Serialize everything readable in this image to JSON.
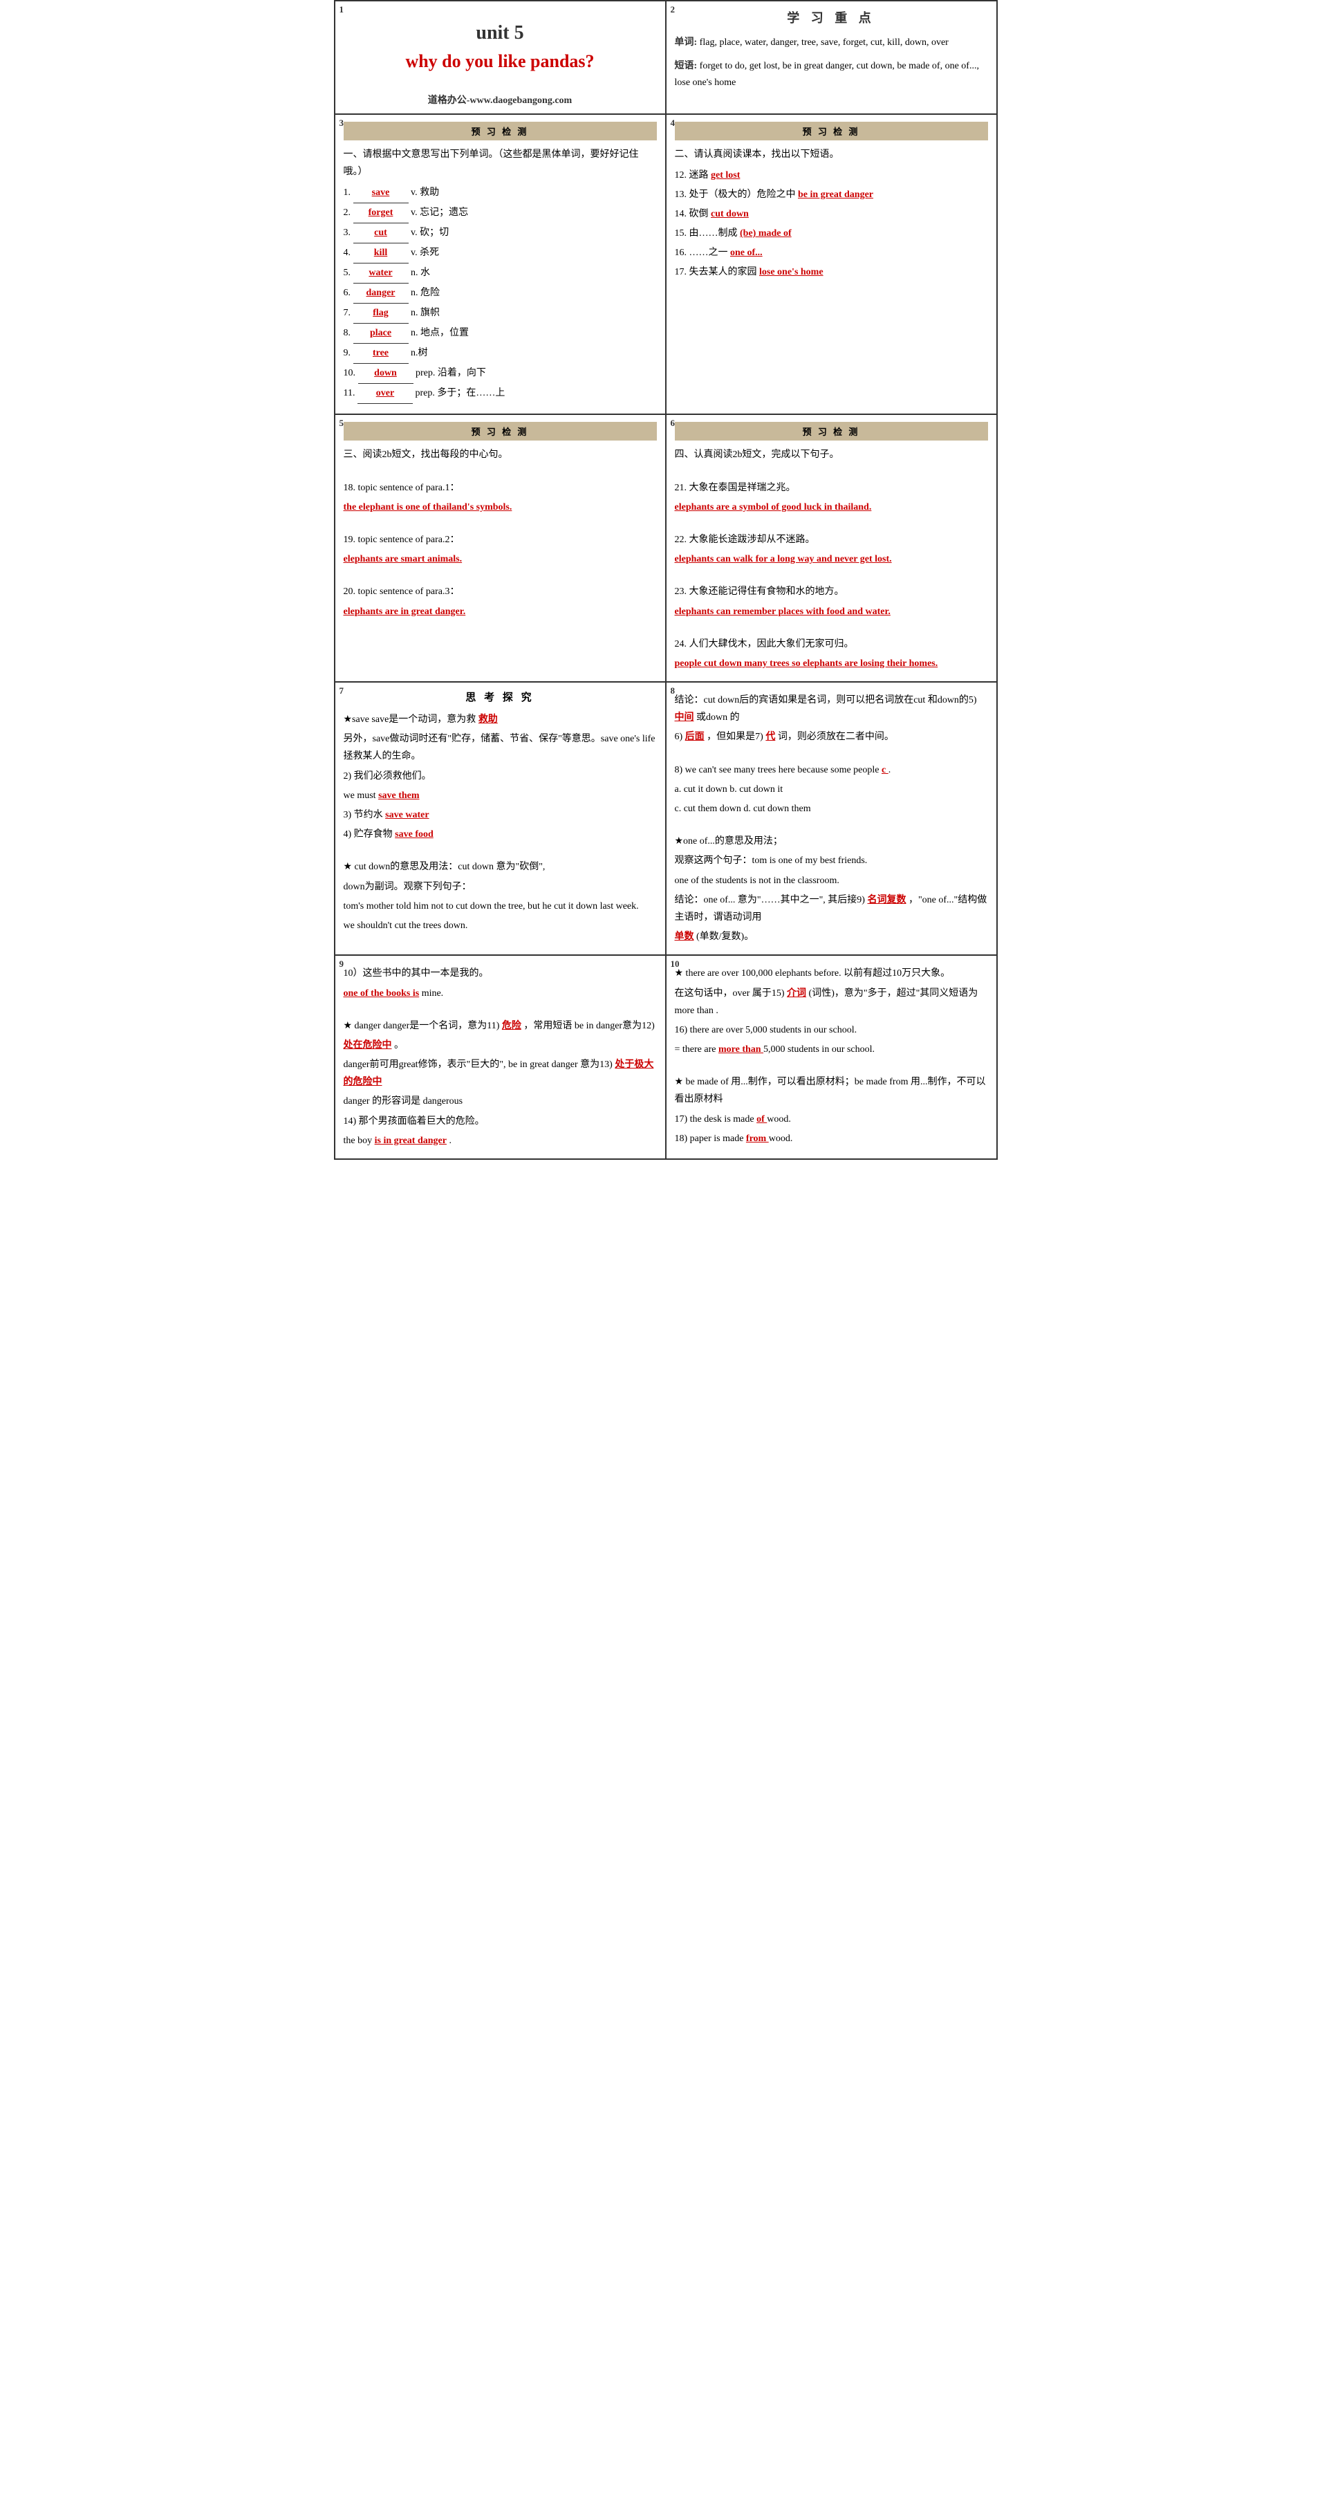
{
  "cell1": {
    "num": "1",
    "unit": "unit 5",
    "subtitle": "why do you like pandas?",
    "website": "道格办公-www.daogebangong.com"
  },
  "cell2": {
    "num": "2",
    "title": "学 习 重 点",
    "words_label": "单词:",
    "words": "flag, place, water, danger, tree, save, forget, cut, kill, down, over",
    "phrases_label": "短语:",
    "phrases": "forget to do, get lost, be in great danger, cut down, be made of, one of..., lose one's home"
  },
  "cell3": {
    "num": "3",
    "header": "预 习 检 测",
    "title": "一、请根据中文意思写出下列单词。（这些都是黑体单词，要好好记住哦。）",
    "items": [
      {
        "num": "1.",
        "blank": "save",
        "meaning": "v. 救助"
      },
      {
        "num": "2.",
        "blank": "forget",
        "meaning": "v. 忘记；遗忘"
      },
      {
        "num": "3.",
        "blank": "cut",
        "meaning": "v. 砍；切"
      },
      {
        "num": "4.",
        "blank": "kill",
        "meaning": "v. 杀死"
      },
      {
        "num": "5.",
        "blank": "water",
        "meaning": "n. 水"
      },
      {
        "num": "6.",
        "blank": "danger",
        "meaning": "n. 危险"
      },
      {
        "num": "7.",
        "blank": "flag",
        "meaning": "n. 旗帜"
      },
      {
        "num": "8.",
        "blank": "place",
        "meaning": "n. 地点，位置"
      },
      {
        "num": "9.",
        "blank": "tree",
        "meaning": "n.树"
      },
      {
        "num": "10.",
        "blank": "down",
        "meaning": "prep. 沿着，向下"
      },
      {
        "num": "11.",
        "blank": "over",
        "meaning": "prep. 多于；在……上"
      }
    ]
  },
  "cell4": {
    "num": "4",
    "header": "预 习 检 测",
    "title": "二、请认真阅读课本，找出以下短语。",
    "items": [
      {
        "num": "12.",
        "meaning": "迷路",
        "blank": "get lost"
      },
      {
        "num": "13.",
        "meaning": "处于（极大的）危险之中",
        "blank": "be in great danger"
      },
      {
        "num": "14.",
        "meaning": "砍倒",
        "blank": "cut down"
      },
      {
        "num": "15.",
        "meaning": "由……制成",
        "blank": "(be) made of"
      },
      {
        "num": "16.",
        "meaning": "……之一",
        "blank": "one of..."
      },
      {
        "num": "17.",
        "meaning": "失去某人的家园",
        "blank": "lose one's home"
      }
    ]
  },
  "cell5": {
    "num": "5",
    "header": "预 习 检 测",
    "title": "三、阅读2b短文，找出每段的中心句。",
    "items": [
      {
        "num": "18.",
        "label": "topic sentence of para.1：",
        "blank": "the elephant is one of thailand's symbols."
      },
      {
        "num": "19.",
        "label": "topic sentence of para.2：",
        "blank": "elephants are smart animals."
      },
      {
        "num": "20.",
        "label": "topic sentence of para.3：",
        "blank": "elephants are in great danger."
      }
    ]
  },
  "cell6": {
    "num": "6",
    "header": "预 习 检 测",
    "title": "四、认真阅读2b短文，完成以下句子。",
    "items": [
      {
        "num": "21.",
        "cn": "大象在泰国是祥瑞之兆。",
        "blank": "elephants are a symbol of good luck in thailand."
      },
      {
        "num": "22.",
        "cn": "大象能长途跋涉却从不迷路。",
        "blank": "elephants can walk for a long way and never get lost."
      },
      {
        "num": "23.",
        "cn": "大象还能记得住有食物和水的地方。",
        "blank": "elephants can remember places with food and water."
      },
      {
        "num": "24.",
        "cn": "人们大肆伐木，因此大象们无家可归。",
        "blank": "people cut down many trees so elephants are losing their homes."
      }
    ]
  },
  "cell7": {
    "num": "7",
    "header": "思 考 探 究",
    "content": [
      "★save  save是一个动词，意为救",
      "救助",
      "另外，save做动词时还有\"贮存，储蓄、节省、保存\"等意思。save one's life 拯救某人的生命。",
      "2) 我们必须救他们。",
      "we must  save them",
      "3) 节约水  save water",
      "4) 贮存食物  save food",
      "★ cut down的意思及用法：cut down 意为\"砍倒\",",
      "down为副词。观察下列句子：",
      "  tom's mother told him not to cut down the tree,",
      "but he cut it down last week.",
      "  we shouldn't cut the trees down."
    ]
  },
  "cell8": {
    "num": "8",
    "content": [
      "结论：cut down后的宾语如果是名词，则可以把名词放在cut 和down的5) 中间 或down 的",
      "6) 后面 ，但如果是7) 代 词，则必须放在二者中间。",
      "8) we can't see many trees here because some people  c  .",
      "  a. cut it down     b. cut down it",
      "  c. cut them down    d. cut down them",
      "★one of...的意思及用法；",
      "  观察这两个句子：tom is one of my best friends.",
      "one of the students is not in the classroom.",
      "  结论：one of... 意为\"……其中之一\", 其后接9)",
      "名词复数 ，\"one of...\"结构做主语时，谓语动词用",
      "单数 (单数/复数)。"
    ]
  },
  "cell9": {
    "num": "9",
    "content": [
      "10）这些书中的其中一本是我的。",
      "one of the books is  mine.",
      "★ danger  danger是一个名词，意为11)",
      "危险 ，常用短语 be in danger意为12)",
      "处在危险中 。",
      "danger前可用great修饰，表示\"巨大的\", be in great danger 意为13)  处于极大的危险中",
      "danger 的形容词是 dangerous",
      "14) 那个男孩面临着巨大的危险。",
      "the boy  is in great danger ."
    ]
  },
  "cell10": {
    "num": "10",
    "content": [
      "★ there are over 100,000 elephants before.  以前有超过10万只大象。",
      "在这句话中，over 属于15)  介词  (词性)，意为\"多于，超过\"其同义短语为 more than .",
      "  16) there are over 5,000 students in our school.",
      "= there are  more   than  5,000 students in our school.",
      "★ be made of 用...制作，可以看出原材料；be made from 用...制作，不可以看出原材料",
      "  17) the desk is made  of   wood.",
      "  18) paper is made  from  wood."
    ]
  }
}
